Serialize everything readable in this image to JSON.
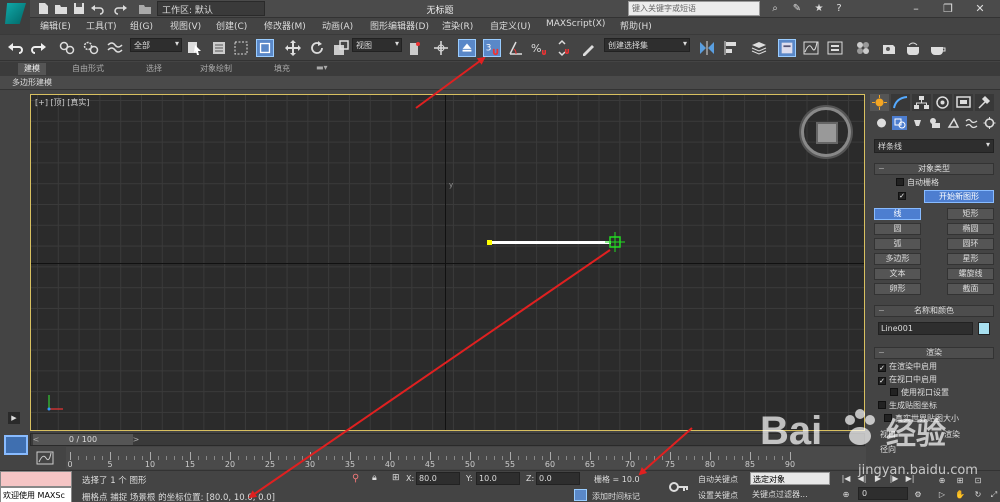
{
  "titlebar": {
    "workspace_label": "工作区: 默认",
    "document_title": "无标题",
    "search_placeholder": "键入关键字或短语"
  },
  "menu": [
    "编辑(E)",
    "工具(T)",
    "组(G)",
    "视图(V)",
    "创建(C)",
    "修改器(M)",
    "动画(A)",
    "图形编辑器(D)",
    "渲染(R)",
    "自定义(U)",
    "MAXScript(X)",
    "帮助(H)"
  ],
  "toolbar": {
    "selection_filter": "全部",
    "ref_coord": "视图",
    "named_selection": "创建选择集",
    "snap_label": "3"
  },
  "ribbon": {
    "tabs": [
      "建模",
      "自由形式",
      "选择",
      "对象绘制",
      "填充"
    ],
    "active_tab": "建模",
    "subpanel": "多边形建模"
  },
  "viewport": {
    "label": "[+] [顶] [真实]",
    "y_axis_label": "y"
  },
  "command_panel": {
    "category": "样条线",
    "object_type_title": "对象类型",
    "auto_grid": "自动栅格",
    "start_new_shape": "开始新图形",
    "start_new_shape_checked": true,
    "buttons": [
      "线",
      "矩形",
      "圆",
      "椭圆",
      "弧",
      "圆环",
      "多边形",
      "星形",
      "文本",
      "螺旋线",
      "卵形",
      "截面"
    ],
    "active_button": "线",
    "name_color_title": "名称和颜色",
    "object_name": "Line001",
    "object_color": "#a8e0f0",
    "render_title": "渲染",
    "render_options": [
      {
        "label": "在渲染中启用",
        "checked": true
      },
      {
        "label": "在视口中启用",
        "checked": true
      },
      {
        "label": "使用视口设置",
        "checked": false
      },
      {
        "label": "生成贴图坐标",
        "checked": false
      },
      {
        "label": "真实世界贴图大小",
        "checked": false
      }
    ],
    "viewport_label": "视口",
    "render_label": "渲染",
    "radial_label": "径向"
  },
  "timeline": {
    "slider_text": "0 / 100",
    "ticks": [
      0,
      5,
      10,
      15,
      20,
      25,
      30,
      35,
      40,
      45,
      50,
      55,
      60,
      65,
      70,
      75,
      80,
      85,
      90
    ]
  },
  "status": {
    "maxscript_listener": "",
    "welcome": "欢迎使用 MAXSc",
    "selection_text": "选择了 1 个 图形",
    "prompt_text": "栅格点 捕捉 场景根 的坐标位置: [80.0, 10.0, 0.0]",
    "x_label": "X:",
    "x_value": "80.0",
    "y_label": "Y:",
    "y_value": "10.0",
    "z_label": "Z:",
    "z_value": "0.0",
    "grid_text": "栅格 = 10.0",
    "add_time_tag": "添加时间标记",
    "auto_key": "自动关键点",
    "set_key": "设置关键点",
    "selected_object": "选定对象",
    "key_filters": "关键点过滤器...",
    "frame": "0"
  },
  "watermark": {
    "line1": "Bai",
    "line2": "经验",
    "url": "jingyan.baidu.com"
  },
  "colors": {
    "accent": "#4d7ed0",
    "viewport_border": "#d8c060",
    "annotation_arrow": "#e02020",
    "snap_green": "#22dd22"
  }
}
